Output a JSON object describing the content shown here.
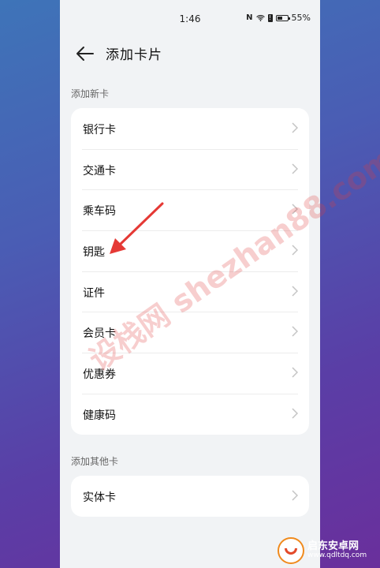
{
  "status_bar": {
    "time": "1:46",
    "battery_percent": "55%",
    "battery_level": 0.55
  },
  "header": {
    "title": "添加卡片"
  },
  "sections": [
    {
      "title": "添加新卡",
      "items": [
        {
          "label": "银行卡"
        },
        {
          "label": "交通卡"
        },
        {
          "label": "乘车码"
        },
        {
          "label": "钥匙"
        },
        {
          "label": "证件"
        },
        {
          "label": "会员卡"
        },
        {
          "label": "优惠券"
        },
        {
          "label": "健康码"
        }
      ]
    },
    {
      "title": "添加其他卡",
      "items": [
        {
          "label": "实体卡"
        }
      ]
    }
  ],
  "watermark": {
    "text": "设栈网 shezhan88.com"
  },
  "logo": {
    "name": "启东安卓网",
    "url": "www.qdltdq.com"
  },
  "colors": {
    "arrow": "#e53935",
    "accent_bg": "#5a3ea6"
  }
}
